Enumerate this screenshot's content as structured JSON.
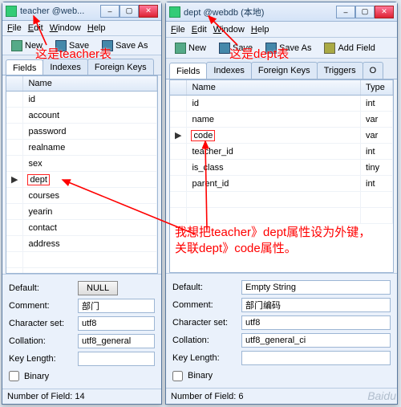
{
  "left": {
    "title": "teacher @web...",
    "menu": {
      "file": "File",
      "edit": "Edit",
      "window": "Window",
      "help": "Help"
    },
    "toolbar": {
      "new": "New",
      "save": "Save",
      "saveas": "Save As"
    },
    "tabs": {
      "fields": "Fields",
      "indexes": "Indexes",
      "foreignkeys": "Foreign Keys"
    },
    "header": {
      "name": "Name"
    },
    "fields": [
      "id",
      "account",
      "password",
      "realname",
      "sex",
      "dept",
      "courses",
      "yearin",
      "contact",
      "address"
    ],
    "highlightField": "dept",
    "selectedIdx": 5,
    "props": {
      "default_lbl": "Default:",
      "default_val": "NULL",
      "comment_lbl": "Comment:",
      "comment_val": "部门",
      "charset_lbl": "Character set:",
      "charset_val": "utf8",
      "collation_lbl": "Collation:",
      "collation_val": "utf8_general",
      "keylen_lbl": "Key Length:",
      "keylen_val": "",
      "binary_lbl": "Binary"
    },
    "status": "Number of Field: 14"
  },
  "right": {
    "title": "dept @webdb (本地)",
    "menu": {
      "file": "File",
      "edit": "Edit",
      "window": "Window",
      "help": "Help"
    },
    "toolbar": {
      "new": "New",
      "save": "Save",
      "saveas": "Save As",
      "addfield": "Add Field"
    },
    "tabs": {
      "fields": "Fields",
      "indexes": "Indexes",
      "foreignkeys": "Foreign Keys",
      "triggers": "Triggers",
      "o": "O"
    },
    "header": {
      "name": "Name",
      "type": "Type"
    },
    "fields": [
      {
        "n": "id",
        "t": "int"
      },
      {
        "n": "name",
        "t": "var"
      },
      {
        "n": "code",
        "t": "var"
      },
      {
        "n": "teacher_id",
        "t": "int"
      },
      {
        "n": "is_class",
        "t": "tiny"
      },
      {
        "n": "parent_id",
        "t": "int"
      }
    ],
    "highlightField": "code",
    "selectedIdx": 2,
    "props": {
      "default_lbl": "Default:",
      "default_val": "Empty String",
      "comment_lbl": "Comment:",
      "comment_val": "部门编码",
      "charset_lbl": "Character set:",
      "charset_val": "utf8",
      "collation_lbl": "Collation:",
      "collation_val": "utf8_general_ci",
      "keylen_lbl": "Key Length:",
      "keylen_val": "",
      "binary_lbl": "Binary"
    },
    "status": "Number of Field: 6"
  },
  "annotations": {
    "a1": "这是teacher表",
    "a2": "这是dept表",
    "a3": "我想把teacher》dept属性设为外键，关联dept》code属性。"
  },
  "watermark": "Baidu"
}
